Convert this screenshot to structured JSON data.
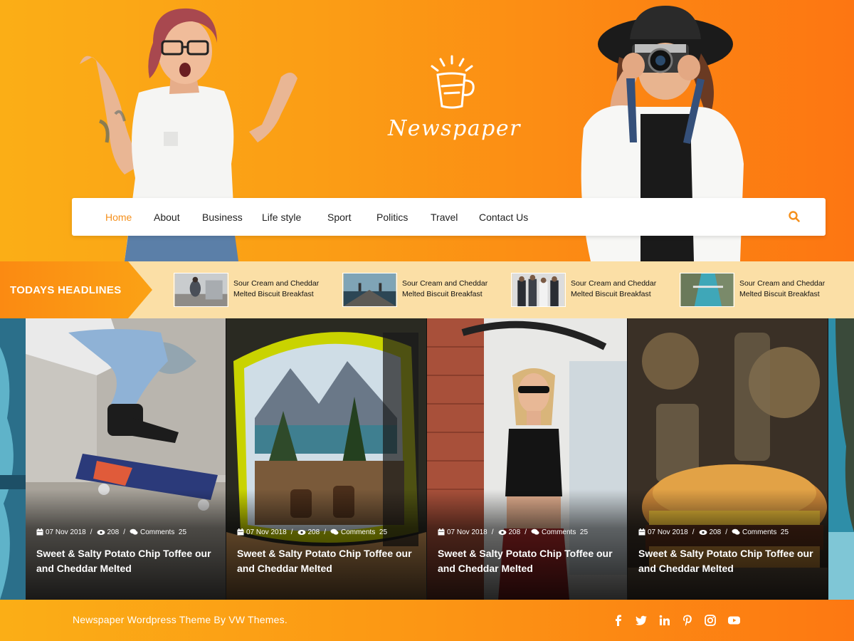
{
  "site": {
    "logo_text": "Newspaper",
    "accent_color": "#f5901c",
    "gradient_start": "#fbae16",
    "gradient_end": "#fd7612"
  },
  "nav": {
    "items": [
      {
        "label": "Home",
        "active": true
      },
      {
        "label": "About"
      },
      {
        "label": "Business"
      },
      {
        "label": "Life style"
      },
      {
        "label": "Sport"
      },
      {
        "label": "Politics"
      },
      {
        "label": "Travel"
      },
      {
        "label": "Contact Us"
      }
    ],
    "search_icon": "search-icon"
  },
  "headlines": {
    "label": "TODAYS HEADLINES",
    "items": [
      {
        "title": "Sour Cream and Cheddar Melted Biscuit Breakfast"
      },
      {
        "title": "Sour Cream and Cheddar Melted Biscuit Breakfast"
      },
      {
        "title": "Sour Cream and Cheddar Melted Biscuit Breakfast"
      },
      {
        "title": "Sour Cream and Cheddar Melted Biscuit Breakfast"
      }
    ]
  },
  "cards": [
    {
      "date": "07 Nov 2018",
      "views": "208",
      "comments_label": "Comments",
      "comments": "25",
      "title": "Sweet & Salty Potato Chip Toffee our and Cheddar Melted"
    },
    {
      "date": "07 Nov 2018",
      "views": "208",
      "comments_label": "Comments",
      "comments": "25",
      "title": "Sweet & Salty Potato Chip Toffee our and Cheddar Melted"
    },
    {
      "date": "07 Nov 2018",
      "views": "208",
      "comments_label": "Comments",
      "comments": "25",
      "title": "Sweet & Salty Potato Chip Toffee our and Cheddar Melted"
    },
    {
      "date": "07 Nov 2018",
      "views": "208",
      "comments_label": "Comments",
      "comments": "25",
      "title": "Sweet & Salty Potato Chip Toffee our and Cheddar Melted"
    }
  ],
  "footer": {
    "text": "Newspaper Wordpress Theme By VW Themes.",
    "social_icons": [
      "facebook-icon",
      "twitter-icon",
      "linkedin-icon",
      "pinterest-icon",
      "instagram-icon",
      "youtube-icon"
    ]
  }
}
